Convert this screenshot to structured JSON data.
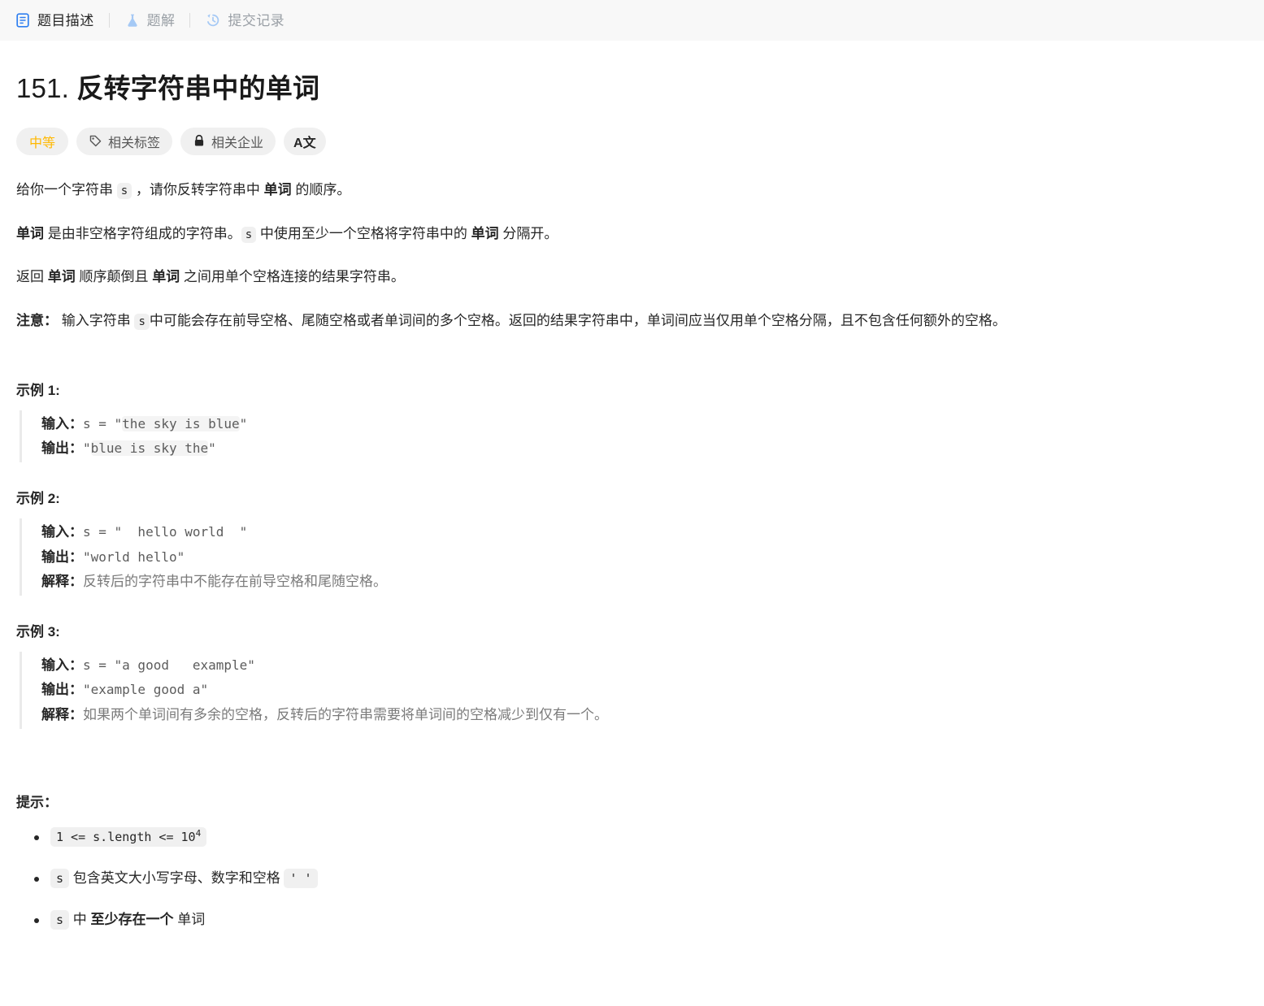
{
  "tabs": [
    {
      "id": "description",
      "label": "题目描述",
      "icon": "document-icon",
      "active": true
    },
    {
      "id": "solution",
      "label": "题解",
      "icon": "flask-icon",
      "active": false
    },
    {
      "id": "submissions",
      "label": "提交记录",
      "icon": "history-icon",
      "active": false
    }
  ],
  "problem": {
    "number": "151.",
    "title": "反转字符串中的单词",
    "full_title": "151. 反转字符串中的单词"
  },
  "pills": [
    {
      "id": "difficulty",
      "label": "中等",
      "icon": null,
      "color": "#ffb800"
    },
    {
      "id": "topics",
      "label": "相关标签",
      "icon": "tag-icon"
    },
    {
      "id": "companies",
      "label": "相关企业",
      "icon": "lock-icon"
    },
    {
      "id": "translate",
      "label": "A文",
      "icon": "translate-icon"
    }
  ],
  "description": {
    "p1": {
      "a": "给你一个字符串 ",
      "code1": "s",
      "b": " ，请你反转字符串中 ",
      "bold1": "单词",
      "c": " 的顺序。"
    },
    "p2": {
      "bold1": "单词",
      "a": " 是由非空格字符组成的字符串。",
      "code1": "s",
      "b": " 中使用至少一个空格将字符串中的 ",
      "bold2": "单词",
      "c": " 分隔开。"
    },
    "p3": {
      "a": "返回 ",
      "bold1": "单词",
      "b": " 顺序颠倒且 ",
      "bold2": "单词",
      "c": " 之间用单个空格连接的结果字符串。"
    },
    "p4": {
      "bold1": "注意：",
      "a": " 输入字符串 ",
      "code1": "s",
      "b": "中可能会存在前导空格、尾随空格或者单词间的多个空格。返回的结果字符串中，单词间应当仅用单个空格分隔，且不包含任何额外的空格。"
    }
  },
  "examples": [
    {
      "title": "示例 1:",
      "input_label": "输入：",
      "input_prefix": "s = \"",
      "input_code": "the sky is blue",
      "input_suffix": "\"",
      "output_label": "输出：",
      "output_prefix": "\"",
      "output_code": "blue is sky the",
      "output_suffix": "\"",
      "explanation_label": null,
      "explanation": null
    },
    {
      "title": "示例 2:",
      "input_label": "输入：",
      "input_plain": "s = \"  hello world  \"",
      "output_label": "输出：",
      "output_plain": "\"world hello\"",
      "explanation_label": "解释：",
      "explanation": "反转后的字符串中不能存在前导空格和尾随空格。"
    },
    {
      "title": "示例 3:",
      "input_label": "输入：",
      "input_plain": "s = \"a good   example\"",
      "output_label": "输出：",
      "output_plain": "\"example good a\"",
      "explanation_label": "解释：",
      "explanation": "如果两个单词间有多余的空格，反转后的字符串需要将单词间的空格减少到仅有一个。"
    }
  ],
  "constraints": {
    "title": "提示：",
    "items": [
      {
        "id": "length",
        "code": "1 <= s.length <= 10",
        "sup": "4",
        "text": null
      },
      {
        "id": "charset",
        "code": "s",
        "text": " 包含英文大小写字母、数字和空格 ",
        "code2": "' '"
      },
      {
        "id": "atleastone",
        "code": "s",
        "text_a": " 中 ",
        "bold": "至少存在一个",
        "text_b": " 单词"
      }
    ]
  }
}
